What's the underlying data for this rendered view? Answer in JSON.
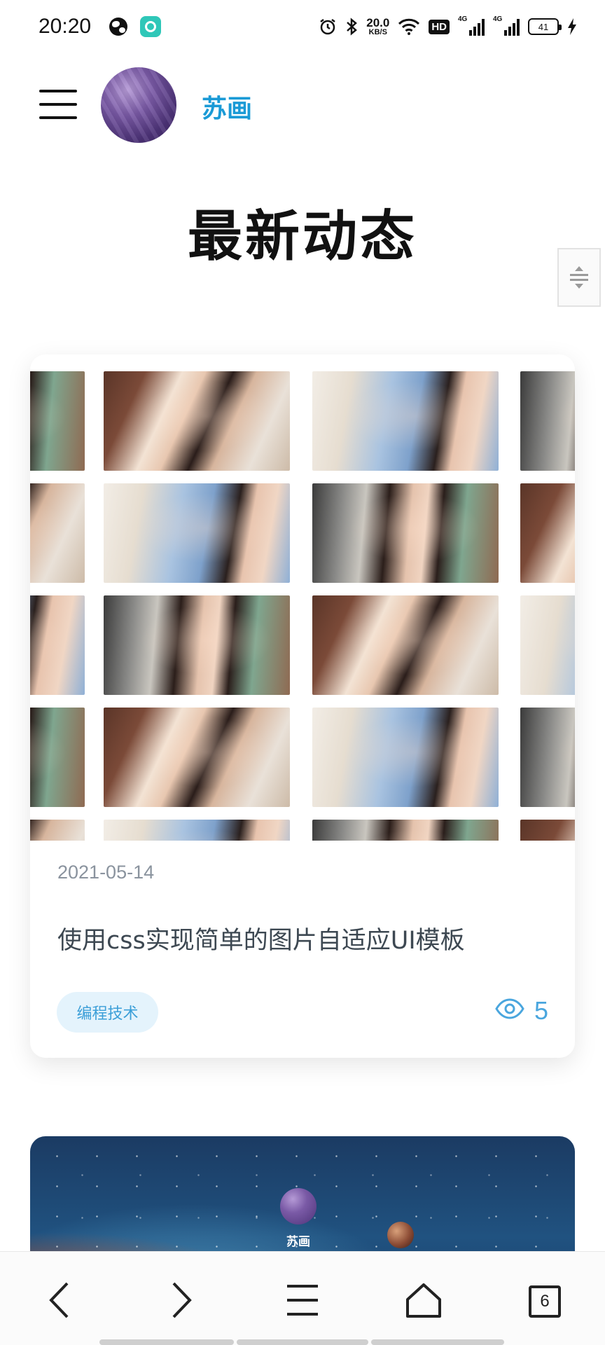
{
  "status_bar": {
    "time": "20:20",
    "net_speed_value": "20.0",
    "net_speed_unit": "KB/S",
    "hd_label": "HD",
    "signal_label_1": "4G",
    "signal_label_2": "4G",
    "battery": "41"
  },
  "header": {
    "site_name": "苏画",
    "menu_icon": "hamburger-menu-icon"
  },
  "page_title": "最新动态",
  "posts": [
    {
      "date": "2021-05-14",
      "title": "使用css实现简单的图片自适应UI模板",
      "tag": "编程技术",
      "views": "5"
    },
    {
      "author": "苏画"
    }
  ],
  "bottom_nav": {
    "tab_count": "6",
    "icons": [
      "back-arrow-icon",
      "forward-arrow-icon",
      "menu-icon",
      "home-icon",
      "tabs-icon"
    ]
  },
  "colors": {
    "accent": "#1a9ad6",
    "tag_bg": "#e4f3fc",
    "tag_text": "#3c9fd8",
    "meta_text": "#8a939e"
  }
}
